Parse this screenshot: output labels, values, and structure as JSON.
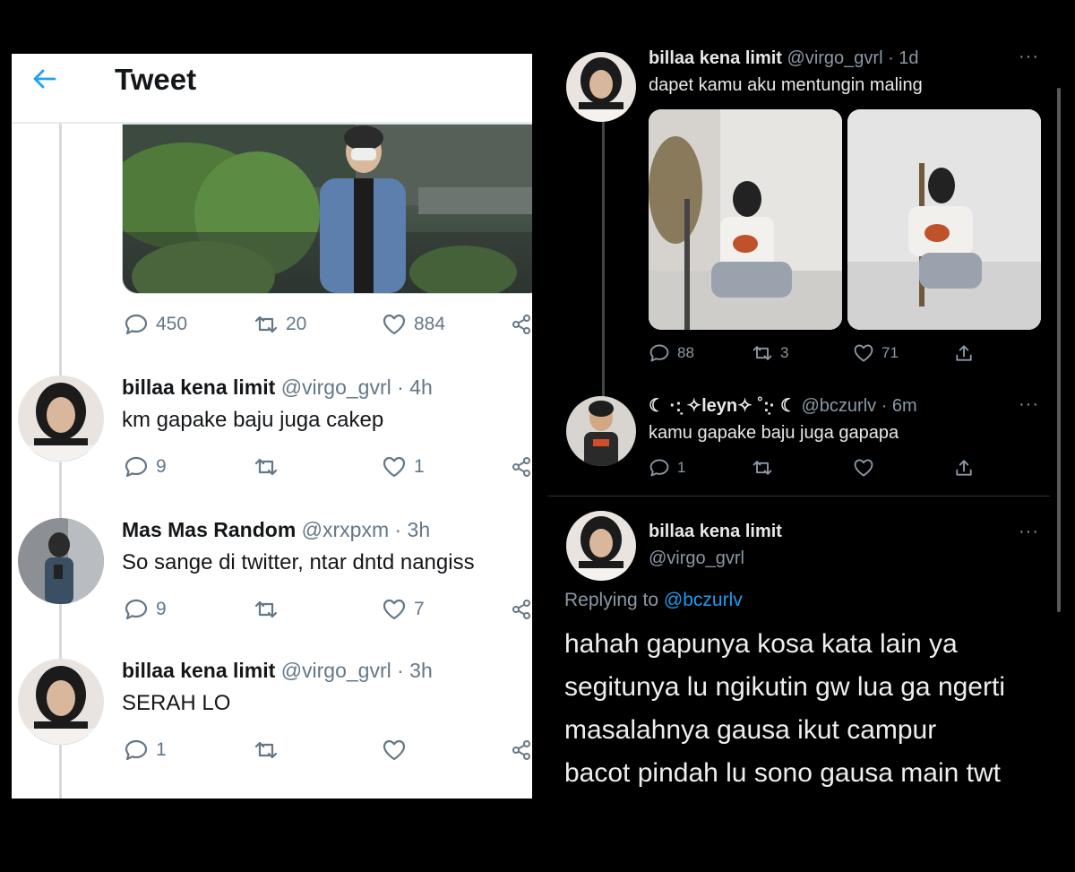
{
  "colors": {
    "accent_light": "#1da1f2",
    "accent_dark": "#1d9bf0",
    "muted": "#657786"
  },
  "left": {
    "header": {
      "title": "Tweet",
      "back_icon": "arrow-left-icon"
    },
    "main_actions": {
      "replies": "450",
      "retweets": "20",
      "likes": "884"
    },
    "replies": [
      {
        "name": "billaa kena limit",
        "handle": "@virgo_gvrl · 4h",
        "text": "km gapake baju juga cakep",
        "reply_count": "9",
        "retweet_count": "",
        "like_count": "1"
      },
      {
        "name": "Mas Mas Random",
        "handle": "@xrxpxm · 3h",
        "text": "So sange di twitter, ntar dntd nangiss",
        "reply_count": "9",
        "retweet_count": "",
        "like_count": "7"
      },
      {
        "name": "billaa kena limit",
        "handle": "@virgo_gvrl · 3h",
        "text": "SERAH LO",
        "reply_count": "1",
        "retweet_count": "",
        "like_count": ""
      }
    ]
  },
  "right": {
    "top_tweet": {
      "name": "billaa kena limit",
      "handle": "@virgo_gvrl · 1d",
      "text": "dapet kamu aku mentungin maling",
      "reply_count": "88",
      "retweet_count": "3",
      "like_count": "71"
    },
    "reply_tweet": {
      "name": "☾ ·:̣ ✧leyn✧ ˚:̣· ☾",
      "handle": "@bczurlv · 6m",
      "text": "kamu gapake baju juga gapapa",
      "reply_count": "1",
      "retweet_count": "",
      "like_count": ""
    },
    "final_tweet": {
      "name": "billaa kena limit",
      "handle": "@virgo_gvrl",
      "replying_label": "Replying to",
      "replying_mention": "@bczurlv",
      "lines": [
        "hahah gapunya kosa kata lain ya",
        "segitunya lu ngikutin gw lua ga ngerti",
        "masalahnya gausa ikut campur",
        "bacot pindah lu sono gausa main twt"
      ]
    },
    "more_label": "···"
  }
}
